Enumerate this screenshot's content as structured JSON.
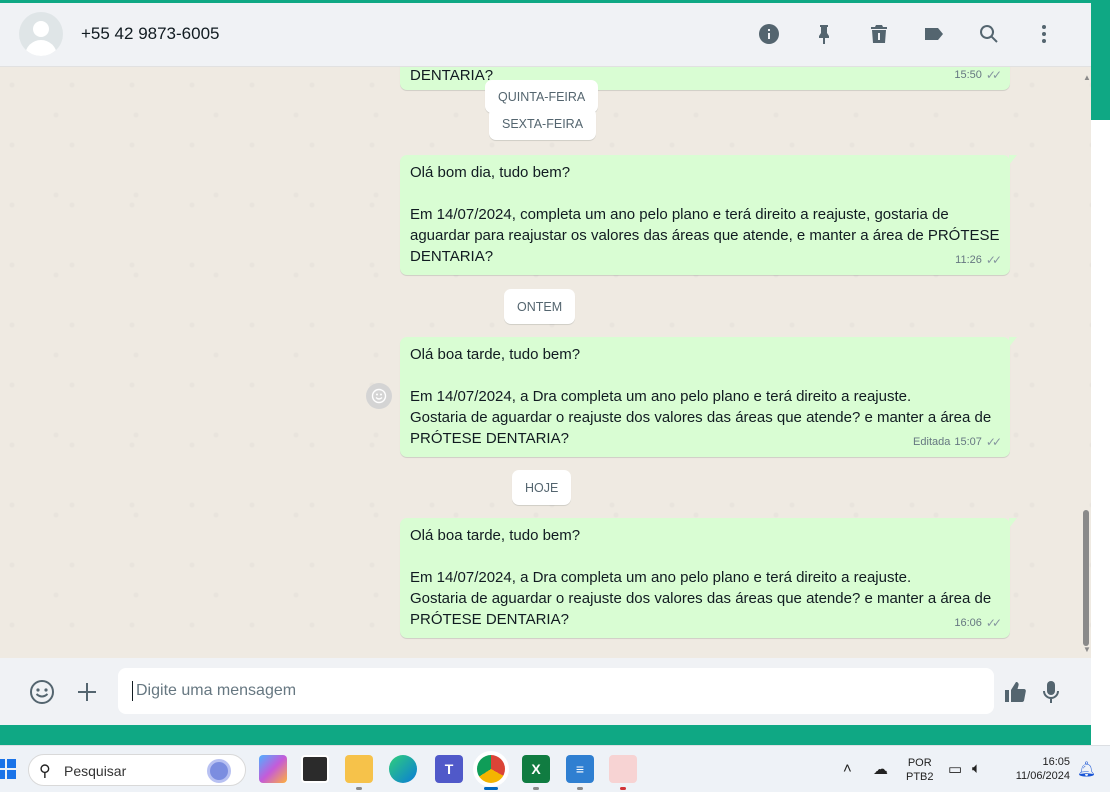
{
  "header": {
    "contact_name": "+55 42 9873-6005",
    "icons": [
      "info-icon",
      "pin-icon",
      "delete-icon",
      "label-icon",
      "search-icon",
      "menu-icon"
    ]
  },
  "chat": {
    "top_partial": {
      "text": "DENTARIA?",
      "time": "15:50"
    },
    "date_chips": {
      "thursday": "QUINTA-FEIRA",
      "friday": "SEXTA-FEIRA",
      "yesterday": "ONTEM",
      "today": "HOJE"
    },
    "messages": [
      {
        "text": "Olá bom dia, tudo bem?\n\nEm 14/07/2024, completa um ano pelo plano e terá direito a reajuste, gostaria de aguardar para reajustar os valores das áreas que atende, e manter a área de PRÓTESE DENTARIA?",
        "time": "11:26",
        "edited": ""
      },
      {
        "text": "Olá boa tarde, tudo bem?\n\nEm 14/07/2024, a Dra completa um ano pelo plano e terá direito a reajuste.\nGostaria de aguardar o reajuste dos valores das áreas que atende? e manter a área de PRÓTESE DENTARIA?",
        "time": "15:07",
        "edited": "Editada"
      },
      {
        "text": "Olá boa tarde, tudo bem?\n\nEm 14/07/2024, a Dra completa um ano pelo plano e terá direito a reajuste.\nGostaria de aguardar o reajuste dos valores das áreas que atende? e manter a área de PRÓTESE DENTARIA?",
        "time": "16:06",
        "edited": ""
      }
    ]
  },
  "composer": {
    "placeholder": "Digite uma mensagem"
  },
  "taskbar": {
    "search_label": "Pesquisar",
    "language": "POR",
    "keyboard": "PTB2",
    "time": "16:05",
    "date": "11/06/2024"
  },
  "colors": {
    "outgoing_bubble": "#d9fdd3",
    "chat_bg": "#efeae2",
    "frame": "#0fa884"
  }
}
